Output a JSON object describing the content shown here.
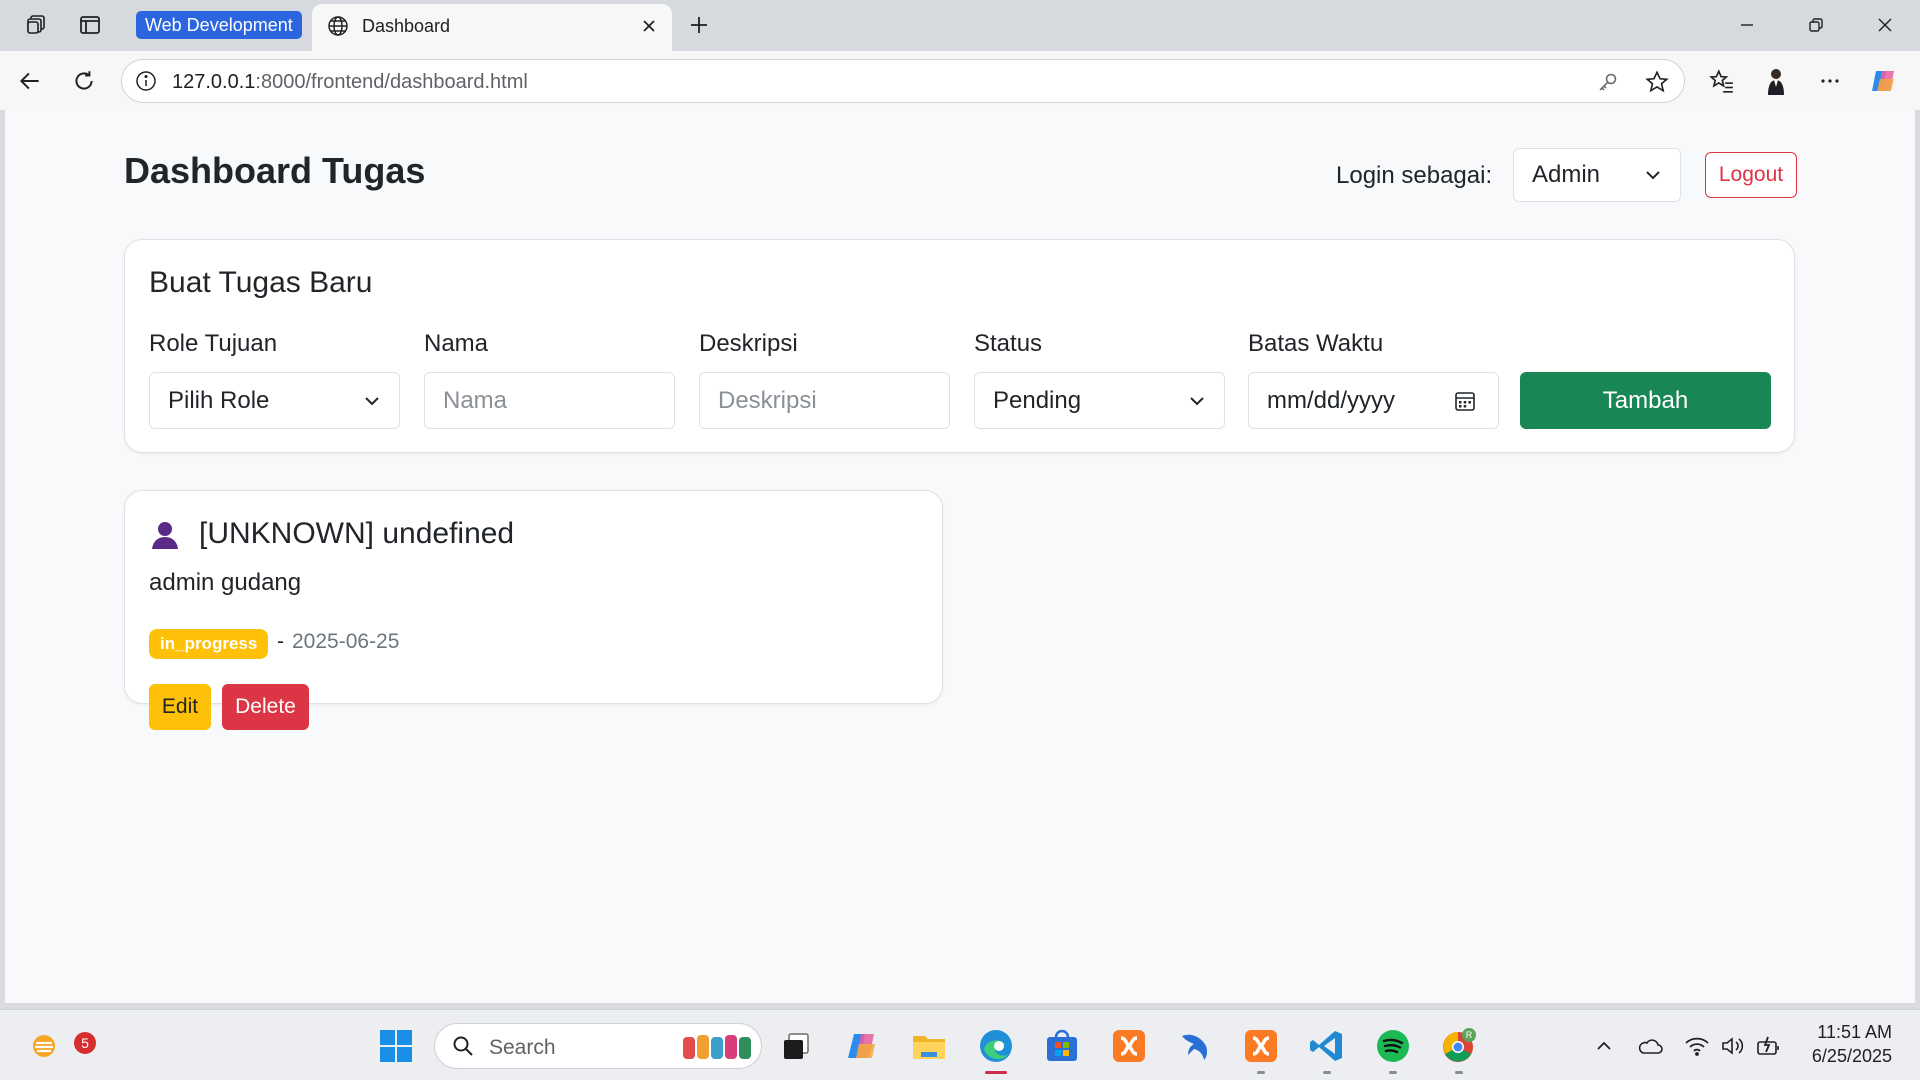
{
  "browser": {
    "tab_group": "Web Development",
    "tab_title": "Dashboard",
    "url_host": "127.0.0.1",
    "url_rest": ":8000/frontend/dashboard.html"
  },
  "header": {
    "title": "Dashboard Tugas",
    "login_label": "Login sebagai:",
    "role_selected": "Admin",
    "logout": "Logout"
  },
  "form": {
    "title": "Buat Tugas Baru",
    "role_label": "Role Tujuan",
    "role_value": "Pilih Role",
    "name_label": "Nama",
    "name_placeholder": "Nama",
    "desc_label": "Deskripsi",
    "desc_placeholder": "Deskripsi",
    "status_label": "Status",
    "status_value": "Pending",
    "deadline_label": "Batas Waktu",
    "deadline_placeholder": "mm/dd/yyyy",
    "submit": "Tambah"
  },
  "tasks": [
    {
      "title": "[UNKNOWN] undefined",
      "description": "admin gudang",
      "status": "in_progress",
      "separator": "-",
      "date": "2025-06-25",
      "edit": "Edit",
      "delete": "Delete"
    }
  ],
  "taskbar": {
    "search": "Search",
    "notification_count": "5",
    "time": "11:51 AM",
    "date": "6/25/2025"
  },
  "colors": {
    "success": "#198754",
    "danger": "#dc3545",
    "warning": "#ffc107",
    "tab_group": "#2b66e0"
  }
}
